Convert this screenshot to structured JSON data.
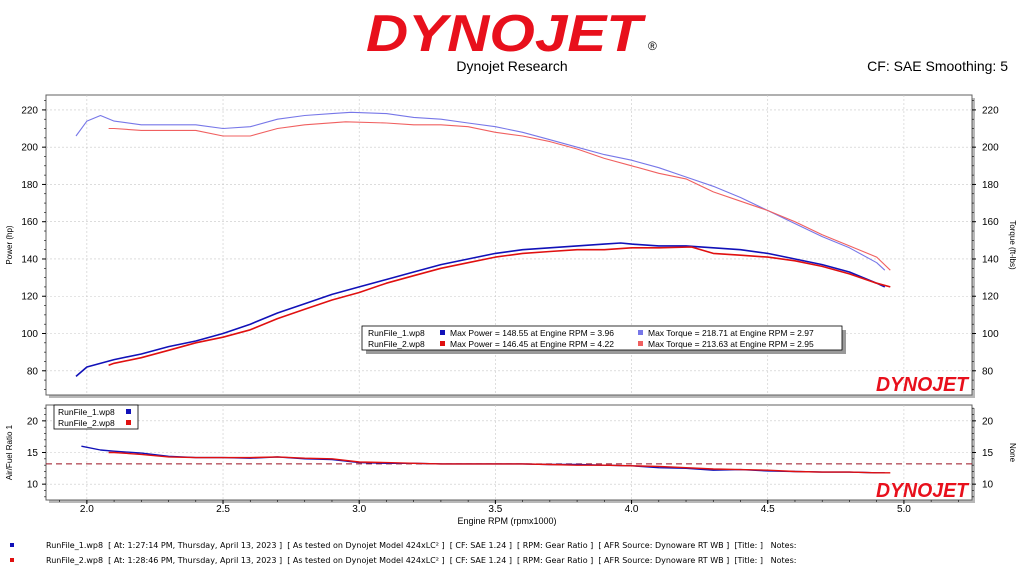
{
  "header": {
    "brand": "DYNOJET",
    "registered": "®",
    "subtitle": "Dynojet Research",
    "cf_smoothing": "CF: SAE Smoothing: 5"
  },
  "watermark": "DYNOJET",
  "colors": {
    "run1_power": "#1111b8",
    "run1_torque": "#7777e8",
    "run2_power": "#e01010",
    "run2_torque": "#f06060",
    "brand_red": "#e8101c",
    "target_line": "#9a1020"
  },
  "chart_data": [
    {
      "type": "line",
      "xlabel": "Engine RPM (rpmx1000)",
      "ylabel_left": "Power (hp)",
      "ylabel_right": "Torque (ft-lbs)",
      "xlim": [
        1.85,
        5.25
      ],
      "ylim": [
        67,
        228
      ],
      "x_ticks": [
        "2.0",
        "2.5",
        "3.0",
        "3.5",
        "4.0",
        "4.5",
        "5.0"
      ],
      "y_ticks": [
        "80",
        "100",
        "120",
        "140",
        "160",
        "180",
        "200",
        "220"
      ],
      "grid": true,
      "legend_placement": "center",
      "series": [
        {
          "name": "RunFile_1.wp8",
          "quantity": "power",
          "color": "#1111b8",
          "x": [
            1.96,
            2.0,
            2.1,
            2.2,
            2.3,
            2.4,
            2.5,
            2.6,
            2.7,
            2.8,
            2.9,
            3.0,
            3.1,
            3.2,
            3.3,
            3.4,
            3.5,
            3.6,
            3.7,
            3.8,
            3.9,
            3.96,
            4.0,
            4.1,
            4.2,
            4.3,
            4.4,
            4.5,
            4.6,
            4.7,
            4.8,
            4.9,
            4.93
          ],
          "y": [
            77,
            82,
            86,
            89,
            93,
            96,
            100,
            105,
            111,
            116,
            121,
            125,
            129,
            133,
            137,
            140,
            143,
            145,
            146,
            147,
            148,
            148.55,
            148,
            147,
            147,
            146,
            145,
            143,
            140,
            137,
            133,
            127,
            125
          ]
        },
        {
          "name": "RunFile_1.wp8",
          "quantity": "torque",
          "color": "#7777e8",
          "x": [
            1.96,
            2.0,
            2.05,
            2.1,
            2.2,
            2.3,
            2.4,
            2.5,
            2.6,
            2.7,
            2.8,
            2.9,
            2.97,
            3.1,
            3.2,
            3.3,
            3.4,
            3.5,
            3.6,
            3.7,
            3.8,
            3.9,
            4.0,
            4.1,
            4.2,
            4.3,
            4.4,
            4.5,
            4.6,
            4.7,
            4.8,
            4.9,
            4.93
          ],
          "y": [
            206,
            214,
            217,
            214,
            212,
            212,
            212,
            210,
            211,
            215,
            217,
            218,
            218.71,
            218,
            216,
            215,
            213,
            211,
            208,
            204,
            200,
            196,
            193,
            189,
            184,
            179,
            173,
            166,
            159,
            152,
            146,
            138,
            134
          ]
        },
        {
          "name": "RunFile_2.wp8",
          "quantity": "power",
          "color": "#e01010",
          "x": [
            2.08,
            2.1,
            2.2,
            2.3,
            2.4,
            2.5,
            2.6,
            2.7,
            2.8,
            2.9,
            3.0,
            3.1,
            3.2,
            3.3,
            3.4,
            3.5,
            3.6,
            3.7,
            3.8,
            3.9,
            4.0,
            4.1,
            4.22,
            4.3,
            4.4,
            4.5,
            4.6,
            4.7,
            4.8,
            4.9,
            4.95
          ],
          "y": [
            83,
            84,
            87,
            91,
            95,
            98,
            102,
            108,
            113,
            118,
            122,
            127,
            131,
            135,
            138,
            141,
            143,
            144,
            145,
            145,
            146,
            146,
            146.45,
            143,
            142,
            141,
            139,
            136,
            132,
            127,
            125
          ]
        },
        {
          "name": "RunFile_2.wp8",
          "quantity": "torque",
          "color": "#f06060",
          "x": [
            2.08,
            2.1,
            2.2,
            2.3,
            2.4,
            2.5,
            2.6,
            2.7,
            2.8,
            2.95,
            3.1,
            3.2,
            3.3,
            3.4,
            3.5,
            3.6,
            3.7,
            3.8,
            3.9,
            4.0,
            4.1,
            4.2,
            4.3,
            4.4,
            4.5,
            4.6,
            4.7,
            4.8,
            4.9,
            4.95
          ],
          "y": [
            210,
            210,
            209,
            209,
            209,
            206,
            206,
            210,
            212,
            213.63,
            213,
            212,
            212,
            211,
            208,
            206,
            203,
            199,
            194,
            190,
            186,
            183,
            176,
            171,
            166,
            160,
            153,
            147,
            141,
            134
          ]
        }
      ],
      "legend": [
        {
          "file": "RunFile_1.wp8",
          "power_color": "#1111b8",
          "power_text": "Max Power = 148.55 at Engine RPM = 3.96",
          "torque_color": "#7777e8",
          "torque_text": "Max Torque = 218.71 at Engine RPM = 2.97"
        },
        {
          "file": "RunFile_2.wp8",
          "power_color": "#e01010",
          "power_text": "Max Power = 146.45 at Engine RPM = 4.22",
          "torque_color": "#f06060",
          "torque_text": "Max Torque = 213.63 at Engine RPM = 2.95"
        }
      ]
    },
    {
      "type": "line",
      "xlabel": "Engine RPM (rpmx1000)",
      "ylabel_left": "Air/Fuel Ratio 1",
      "ylabel_right": "None",
      "xlim": [
        1.85,
        5.25
      ],
      "ylim": [
        7.5,
        22.5
      ],
      "y_ticks": [
        "10",
        "15",
        "20"
      ],
      "grid": true,
      "legend_placement": "top-left",
      "reference_line": 13.2,
      "series": [
        {
          "name": "RunFile_1.wp8",
          "color": "#1111b8",
          "x": [
            1.98,
            2.05,
            2.1,
            2.2,
            2.3,
            2.4,
            2.5,
            2.6,
            2.7,
            2.8,
            2.9,
            3.0,
            3.1,
            3.2,
            3.3,
            3.4,
            3.5,
            3.6,
            3.7,
            3.8,
            3.9,
            4.0,
            4.1,
            4.2,
            4.3,
            4.4,
            4.5,
            4.6,
            4.7,
            4.8,
            4.9,
            4.93
          ],
          "y": [
            16,
            15.4,
            15.2,
            14.9,
            14.4,
            14.2,
            14.2,
            14.1,
            14.3,
            14.0,
            13.9,
            13.4,
            13.3,
            13.3,
            13.2,
            13.2,
            13.2,
            13.2,
            13.1,
            13.1,
            13.0,
            12.9,
            12.6,
            12.5,
            12.2,
            12.3,
            12.1,
            12.0,
            11.9,
            11.9,
            11.8,
            11.8
          ]
        },
        {
          "name": "RunFile_2.wp8",
          "color": "#e01010",
          "x": [
            2.08,
            2.1,
            2.2,
            2.3,
            2.4,
            2.5,
            2.6,
            2.7,
            2.8,
            2.9,
            3.0,
            3.1,
            3.2,
            3.3,
            3.4,
            3.5,
            3.6,
            3.7,
            3.8,
            3.9,
            4.0,
            4.1,
            4.2,
            4.3,
            4.4,
            4.5,
            4.6,
            4.7,
            4.8,
            4.9,
            4.95
          ],
          "y": [
            15.0,
            15.0,
            14.7,
            14.3,
            14.2,
            14.2,
            14.2,
            14.3,
            14.1,
            14.0,
            13.5,
            13.4,
            13.3,
            13.2,
            13.2,
            13.2,
            13.2,
            13.1,
            13.0,
            13.0,
            12.9,
            12.8,
            12.6,
            12.4,
            12.3,
            12.2,
            12.0,
            11.9,
            11.9,
            11.8,
            11.8
          ]
        }
      ],
      "legend": [
        {
          "file": "RunFile_1.wp8",
          "color": "#1111b8"
        },
        {
          "file": "RunFile_2.wp8",
          "color": "#e01010"
        }
      ]
    }
  ],
  "footer": [
    {
      "color": "#1111b8",
      "text": "RunFile_1.wp8  [ At: 1:27:14 PM, Thursday, April 13, 2023 ]  [ As tested on Dynojet Model 424xLC² ]  [ CF: SAE 1.24 ]  [ RPM: Gear Ratio ]  [ AFR Source: Dynoware RT WB ]  [Title: ]   Notes:"
    },
    {
      "color": "#e01010",
      "text": "RunFile_2.wp8  [ At: 1:28:46 PM, Thursday, April 13, 2023 ]  [ As tested on Dynojet Model 424xLC² ]  [ CF: SAE 1.24 ]  [ RPM: Gear Ratio ]  [ AFR Source: Dynoware RT WB ]  [Title: ]   Notes:"
    }
  ]
}
